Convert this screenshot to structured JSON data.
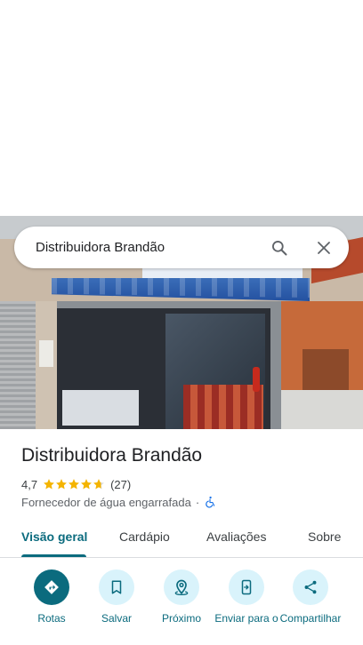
{
  "search": {
    "query": "Distribuidora Brandão",
    "search_icon": "search-icon",
    "close_icon": "close-icon"
  },
  "place": {
    "name": "Distribuidora Brandão",
    "rating": "4,7",
    "rating_stars": 4.7,
    "review_count": "(27)",
    "category": "Fornecedor de água engarrafada",
    "separator": "·",
    "accessibility_icon": "wheelchair-accessible-icon"
  },
  "tabs": [
    {
      "label": "Visão geral",
      "active": true
    },
    {
      "label": "Cardápio",
      "active": false
    },
    {
      "label": "Avaliações",
      "active": false
    },
    {
      "label": "Sobre",
      "active": false
    }
  ],
  "actions": [
    {
      "label": "Rotas",
      "icon": "directions-icon"
    },
    {
      "label": "Salvar",
      "icon": "bookmark-icon"
    },
    {
      "label": "Próximo",
      "icon": "nearby-icon"
    },
    {
      "label": "Enviar para o",
      "icon": "send-to-phone-icon"
    },
    {
      "label": "Compartilhar",
      "icon": "share-icon"
    }
  ],
  "colors": {
    "accent": "#0b6b7e",
    "action_bg": "#d9f3fb",
    "star": "#f4b400"
  }
}
